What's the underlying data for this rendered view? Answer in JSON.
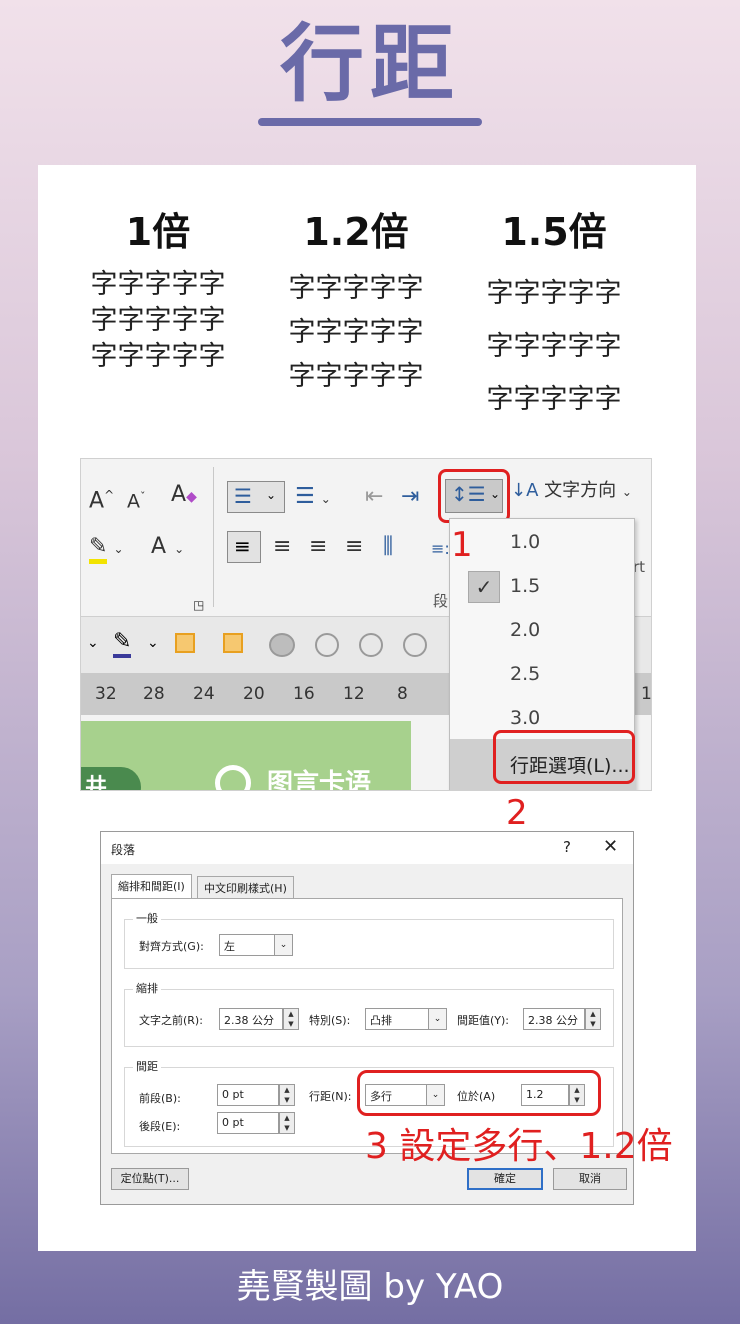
{
  "header": {
    "title": "行距"
  },
  "demo": {
    "columns": [
      {
        "label": "1倍",
        "lines": [
          "字字字字字",
          "字字字字字",
          "字字字字字"
        ]
      },
      {
        "label": "1.2倍",
        "lines": [
          "字字字字字",
          "字字字字字",
          "字字字字字"
        ]
      },
      {
        "label": "1.5倍",
        "lines": [
          "字字字字字",
          "字字字字字",
          "字字字字字"
        ]
      }
    ]
  },
  "ribbon": {
    "font_grow": "A",
    "font_shrink": "A",
    "clear_format": "A",
    "font_color": "A",
    "text_direction": "文字方向",
    "para_group_fragment": "段",
    "right_fragment": "rt",
    "ruler": [
      "32",
      "28",
      "24",
      "20",
      "16",
      "12",
      "8",
      "1"
    ],
    "green_text": "图言卡语",
    "green_pill_text": "井",
    "line_spacing_menu": {
      "items": [
        "1.0",
        "1.5",
        "2.0",
        "2.5",
        "3.0"
      ],
      "checked": "1.5",
      "options_label": "行距選項(L)..."
    }
  },
  "annotations": {
    "step1": "1",
    "step2": "2",
    "step3": "3 設定多行、1.2倍"
  },
  "dialog": {
    "title": "段落",
    "help": "?",
    "close": "✕",
    "tabs": [
      "縮排和間距(I)",
      "中文印刷樣式(H)"
    ],
    "general": {
      "group": "一般",
      "alignment_label": "對齊方式(G):",
      "alignment_value": "左"
    },
    "indent": {
      "group": "縮排",
      "before_label": "文字之前(R):",
      "before_value": "2.38 公分",
      "special_label": "特別(S):",
      "special_value": "凸排",
      "by_label": "間距值(Y):",
      "by_value": "2.38 公分"
    },
    "spacing": {
      "group": "間距",
      "before_label": "前段(B):",
      "before_value": "0 pt",
      "after_label": "後段(E):",
      "after_value": "0 pt",
      "line_label": "行距(N):",
      "line_value": "多行",
      "at_label": "位於(A)",
      "at_value": "1.2"
    },
    "tabs_button": "定位點(T)...",
    "ok": "確定",
    "cancel": "取消"
  },
  "footer": {
    "text": "堯賢製圖 by YAO"
  },
  "colors": {
    "accent": "#6a6aa8",
    "annotation": "#e02020",
    "ribbon_green": "#a7d18d"
  }
}
